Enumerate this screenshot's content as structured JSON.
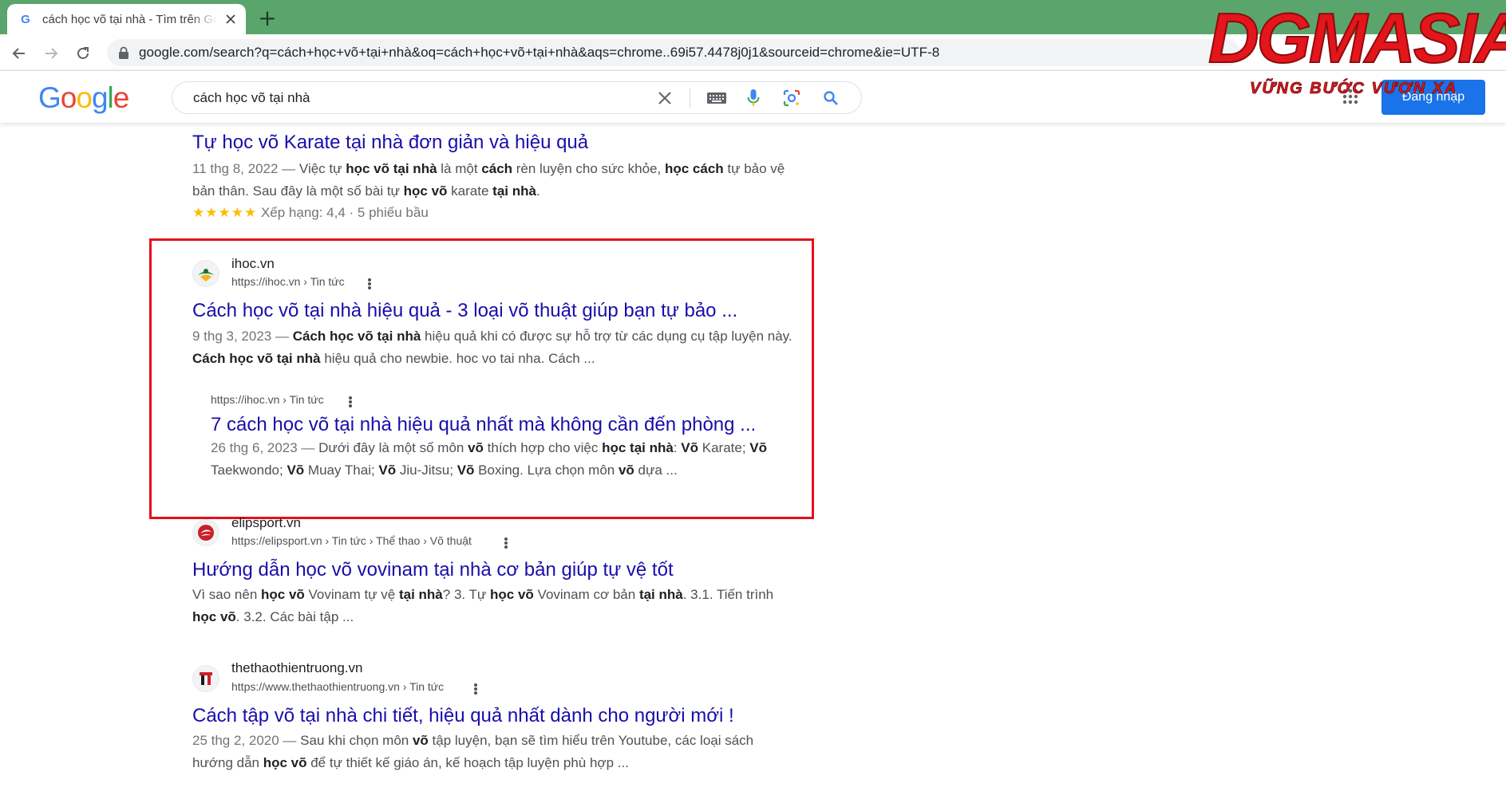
{
  "browser": {
    "tab_title": "cách học võ tại nhà - Tìm trên Google",
    "tab_favicon": "G",
    "new_tab_label": "+",
    "url": "google.com/search?q=cách+học+võ+tại+nhà&oq=cách+học+võ+tại+nhà&aqs=chrome..69i57.4478j0j1&sourceid=chrome&ie=UTF-8"
  },
  "google": {
    "logo_letters": [
      "G",
      "o",
      "o",
      "g",
      "l",
      "e"
    ],
    "logo_colors": [
      "#4285f4",
      "#ea4335",
      "#fbbc05",
      "#4285f4",
      "#34a853",
      "#ea4335"
    ],
    "query": "cách học võ tại nhà",
    "signin_label": "Đăng nhập"
  },
  "results": {
    "r1": {
      "title": "Tự học võ Karate tại nhà đơn giản và hiệu quả",
      "snippet_parts": [
        {
          "t": "11 thg 8, 2022 — ",
          "date": true
        },
        {
          "t": "Việc tự "
        },
        {
          "t": "học võ tại nhà",
          "b": true
        },
        {
          "t": " là một "
        },
        {
          "t": "cách",
          "b": true
        },
        {
          "t": " rèn luyện cho sức khỏe, "
        },
        {
          "t": "học cách",
          "b": true
        },
        {
          "t": " tự bảo vệ bản thân. Sau đây là một số bài tự "
        },
        {
          "t": "học võ",
          "b": true
        },
        {
          "t": " karate "
        },
        {
          "t": "tại nhà",
          "b": true
        },
        {
          "t": "."
        }
      ],
      "stars": "★★★★★",
      "rating_text": "Xếp hạng: 4,4 · 5 phiếu bầu"
    },
    "r2": {
      "site_name": "ihoc.vn",
      "site_url": "https://ihoc.vn › Tin tức",
      "title": "Cách học võ tại nhà hiệu quả - 3 loại võ thuật giúp bạn tự bảo ...",
      "snippet_parts": [
        {
          "t": "9 thg 3, 2023 — ",
          "date": true
        },
        {
          "t": "Cách học võ tại nhà",
          "b": true
        },
        {
          "t": " hiệu quả khi có được sự hỗ trợ từ các dụng cụ tập luyện này. "
        },
        {
          "t": "Cách học võ tại nhà",
          "b": true
        },
        {
          "t": " hiệu quả cho newbie. hoc vo tai nha. Cách ..."
        }
      ],
      "sub": {
        "url": "https://ihoc.vn › Tin tức",
        "title": "7 cách học võ tại nhà hiệu quả nhất mà không cần đến phòng ...",
        "snippet_parts": [
          {
            "t": "26 thg 6, 2023 — ",
            "date": true
          },
          {
            "t": "Dưới đây là một số môn "
          },
          {
            "t": "võ",
            "b": true
          },
          {
            "t": " thích hợp cho việc "
          },
          {
            "t": "học tại nhà",
            "b": true
          },
          {
            "t": ": "
          },
          {
            "t": "Võ",
            "b": true
          },
          {
            "t": " Karate; "
          },
          {
            "t": "Võ",
            "b": true
          },
          {
            "t": " Taekwondo; "
          },
          {
            "t": "Võ",
            "b": true
          },
          {
            "t": " Muay Thai; "
          },
          {
            "t": "Võ",
            "b": true
          },
          {
            "t": " Jiu-Jitsu; "
          },
          {
            "t": "Võ",
            "b": true
          },
          {
            "t": " Boxing. Lựa chọn môn "
          },
          {
            "t": "võ",
            "b": true
          },
          {
            "t": " dựa ..."
          }
        ]
      }
    },
    "r3": {
      "site_name": "elipsport.vn",
      "site_url": "https://elipsport.vn › Tin tức › Thể thao › Võ thuật",
      "title": "Hướng dẫn học võ vovinam tại nhà cơ bản giúp tự vệ tốt",
      "snippet_parts": [
        {
          "t": "Vì sao nên "
        },
        {
          "t": "học võ",
          "b": true
        },
        {
          "t": " Vovinam tự vệ "
        },
        {
          "t": "tại nhà",
          "b": true
        },
        {
          "t": "? 3. Tự "
        },
        {
          "t": "học võ",
          "b": true
        },
        {
          "t": " Vovinam cơ bản "
        },
        {
          "t": "tại nhà",
          "b": true
        },
        {
          "t": ". 3.1. Tiến trình "
        },
        {
          "t": "học võ",
          "b": true
        },
        {
          "t": ". 3.2. Các bài tập ..."
        }
      ]
    },
    "r4": {
      "site_name": "thethaothientruong.vn",
      "site_url": "https://www.thethaothientruong.vn › Tin tức",
      "title": "Cách tập võ tại nhà chi tiết, hiệu quả nhất dành cho người mới !",
      "snippet_parts": [
        {
          "t": "25 thg 2, 2020 — ",
          "date": true
        },
        {
          "t": "Sau khi chọn môn "
        },
        {
          "t": "võ",
          "b": true
        },
        {
          "t": " tập luyện, bạn sẽ tìm hiểu trên Youtube, các loại sách hướng dẫn "
        },
        {
          "t": "học võ",
          "b": true
        },
        {
          "t": " để tự thiết kế giáo án, kế hoạch tập luyện phù hợp ..."
        }
      ]
    }
  },
  "watermark": {
    "main": "DGMASIA",
    "tagline": "VỮNG BƯỚC VƯƠN XA"
  },
  "colors": {
    "tabstrip": "#5aa56c",
    "link": "#1a0dab",
    "highlight_border": "#e3101b",
    "signin": "#1a73e8",
    "stars": "#fbbc04"
  }
}
